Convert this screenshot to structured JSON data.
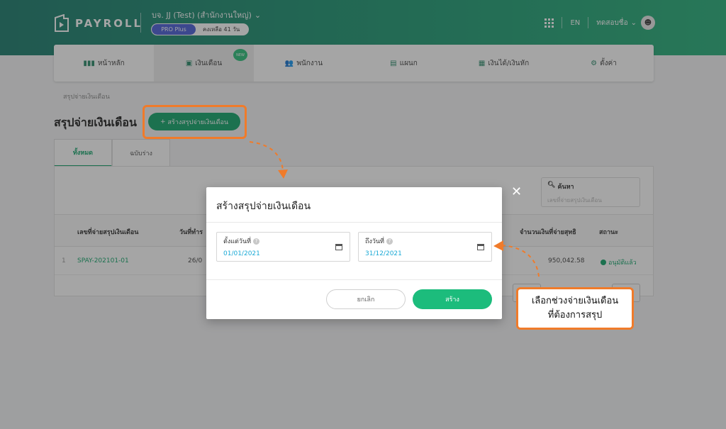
{
  "header": {
    "logo_text": "PAYROLL",
    "company": "บจ. JJ (Test) (สำนักงานใหญ่)",
    "plan_name": "PRO Plus",
    "plan_remaining": "คงเหลือ 41 วัน",
    "language": "EN",
    "user_name": "ทดสอบชื่อ",
    "avatar_text": "☻"
  },
  "nav": {
    "items": [
      {
        "label": "หน้าหลัก",
        "icon": "▮▮▮"
      },
      {
        "label": "เงินเดือน",
        "icon": "▣",
        "badge": "NEW"
      },
      {
        "label": "พนักงาน",
        "icon": "👥"
      },
      {
        "label": "แผนก",
        "icon": "▤"
      },
      {
        "label": "เงินได้/เงินหัก",
        "icon": "▦"
      },
      {
        "label": "ตั้งค่า",
        "icon": "⚙"
      }
    ]
  },
  "page": {
    "breadcrumb": "สรุปจ่ายเงินเดือน",
    "title": "สรุปจ่ายเงินเดือน",
    "create_button": "สร้างสรุปจ่ายเงินเดือน",
    "create_icon": "+",
    "tabs": [
      "ทั้งหมด",
      "ฉบับร่าง"
    ],
    "search_label": "ค้นหา",
    "search_placeholder": "เลขที่จ่ายสรุปเงินเดือน",
    "table": {
      "headers": [
        "เลขที่จ่ายสรุปเงินเดือน",
        "วันที่ทำร",
        "จำนวนเงินที่จ่ายสุทธิ",
        "สถานะ"
      ],
      "rows": [
        {
          "index": "1",
          "number": "SPAY-202101-01",
          "date": "26/0",
          "amount": "950,042.58",
          "status": "อนุมัติแล้ว"
        }
      ]
    }
  },
  "modal": {
    "title": "สร้างสรุปจ่ายเงินเดือน",
    "from_label": "ตั้งแต่วันที่",
    "from_value": "01/01/2021",
    "to_label": "ถึงวันที่",
    "to_value": "31/12/2021",
    "cancel": "ยกเลิก",
    "submit": "สร้าง",
    "close": "✕"
  },
  "callout": {
    "line1": "เลือกช่วงจ่ายเงินเดือน",
    "line2": "ที่ต้องการสรุป"
  },
  "colors": {
    "accent": "#13a56b",
    "annotation": "#f07b2a"
  }
}
